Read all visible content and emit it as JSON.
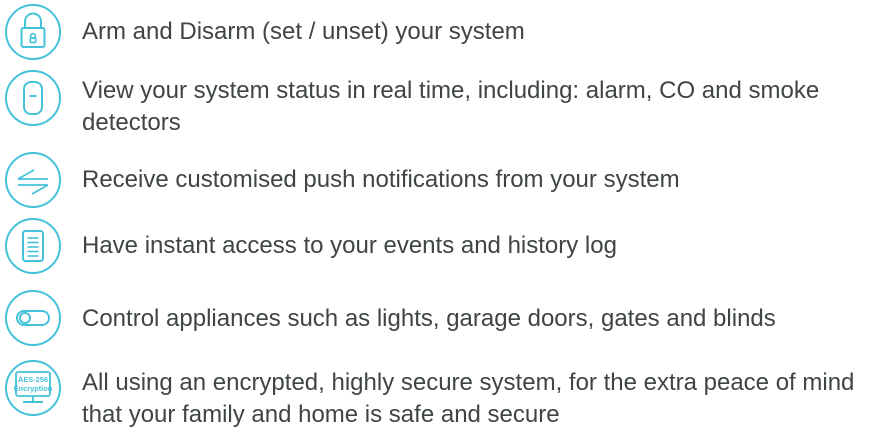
{
  "theme": {
    "accent": "#44c2d9",
    "text": "#3f4447",
    "background": "#ffffff"
  },
  "features": [
    {
      "icon": "padlock-icon",
      "text": "Arm and Disarm (set / unset) your system"
    },
    {
      "icon": "detector-icon",
      "text": "View your system status in real time, including: alarm, CO and smoke detectors"
    },
    {
      "icon": "arrows-icon",
      "text": "Receive customised push notifications from your system"
    },
    {
      "icon": "log-icon",
      "text": "Have instant access to your events and history log"
    },
    {
      "icon": "switch-icon",
      "text": "Control appliances such as lights, garage doors, gates and blinds"
    },
    {
      "icon": "encryption-icon",
      "text": "All using an encrypted, highly secure system, for the extra peace of mind that your family and home is safe and secure"
    }
  ],
  "encryption_badge": {
    "line1": "AES-256",
    "line2": "Encryption"
  }
}
